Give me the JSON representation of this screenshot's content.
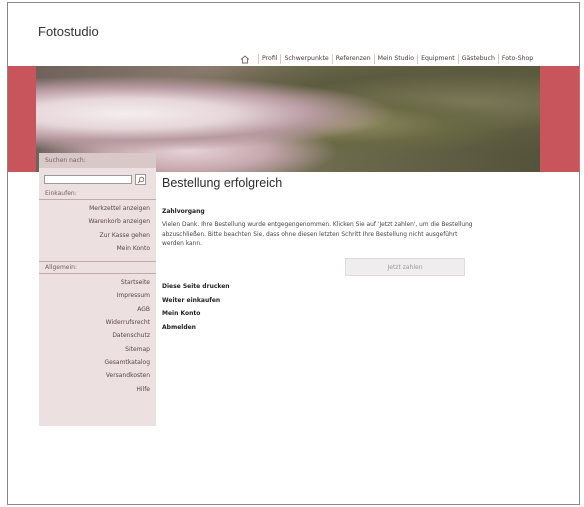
{
  "site": {
    "title": "Fotostudio"
  },
  "topnav": {
    "home_icon": "home-icon",
    "items": [
      "Profil",
      "Schwerpunkte",
      "Referenzen",
      "Mein Studio",
      "Equipment",
      "Gästebuch",
      "Foto-Shop"
    ]
  },
  "sidebar": {
    "search_label": "Suchen nach:",
    "search_placeholder": "",
    "search_icon": "search-icon",
    "einkaufen_title": "Einkaufen:",
    "einkaufen_items": [
      "Merkzettel anzeigen",
      "Warenkorb anzeigen",
      "Zur Kasse gehen",
      "Mein Konto"
    ],
    "allgemein_title": "Allgemein:",
    "allgemein_items": [
      "Startseite",
      "Impressum",
      "AGB",
      "Widerrufsrecht",
      "Datenschutz",
      "Sitemap",
      "Gesamtkatalog",
      "Versandkosten",
      "Hilfe"
    ]
  },
  "main": {
    "title": "Bestellung erfolgreich",
    "section_title": "Zahlvorgang",
    "text": "Vielen Dank. Ihre Bestellung wurde entgegengenommen. Klicken Sie auf 'Jetzt zahlen', um die Bestellung abzuschließen. Bitte beachten Sie, dass ohne diesen letzten Schritt Ihre Bestellung nicht ausgeführt werden kann.",
    "pay_button": "Jetzt zahlen",
    "actions": [
      "Diese Seite drucken",
      "Weiter einkaufen",
      "Mein Konto",
      "Abmelden"
    ]
  },
  "colors": {
    "accent": "#c8545c",
    "sidebar_bg": "#ece0e0",
    "sidebar_header": "#d8c8c8"
  }
}
